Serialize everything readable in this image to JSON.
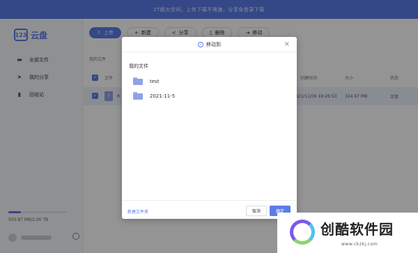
{
  "banner": {
    "text": "2T超大空间，上传下载不限速，分享免登录下载"
  },
  "app": {
    "logo_mark": "123",
    "logo_text": "云盘",
    "accent": "#5b7be8"
  },
  "sidebar": {
    "items": [
      {
        "label": "全部文件",
        "icon": "folder-icon"
      },
      {
        "label": "我的分享",
        "icon": "share-icon"
      },
      {
        "label": "回收站",
        "icon": "trash-icon"
      }
    ],
    "storage_text": "503.87 MB/2.00 TB",
    "storage_used_fraction": 0.0002
  },
  "toolbar": {
    "upload_label": "上传",
    "new_label": "新建",
    "share_label": "分享",
    "delete_label": "删除",
    "move_label": "移动"
  },
  "breadcrumb": {
    "text": "我的文件"
  },
  "table": {
    "headers": {
      "name": "文件",
      "created": "创建时间",
      "size": "大小",
      "status": "状态"
    },
    "rows": [
      {
        "name_prefix": "R",
        "created": "2021/11/09 19:26:53",
        "size": "324.97 MB",
        "status": "正常"
      }
    ]
  },
  "dialog": {
    "title": "移动到",
    "root_label": "我的文件",
    "folders": [
      {
        "name": "test"
      },
      {
        "name": "2021-11-5"
      }
    ],
    "new_folder_label": "新建文件夹",
    "cancel_label": "取消",
    "ok_label": "确定"
  },
  "watermark": {
    "title": "创酷软件园",
    "url": "www.ckzkj.com"
  }
}
